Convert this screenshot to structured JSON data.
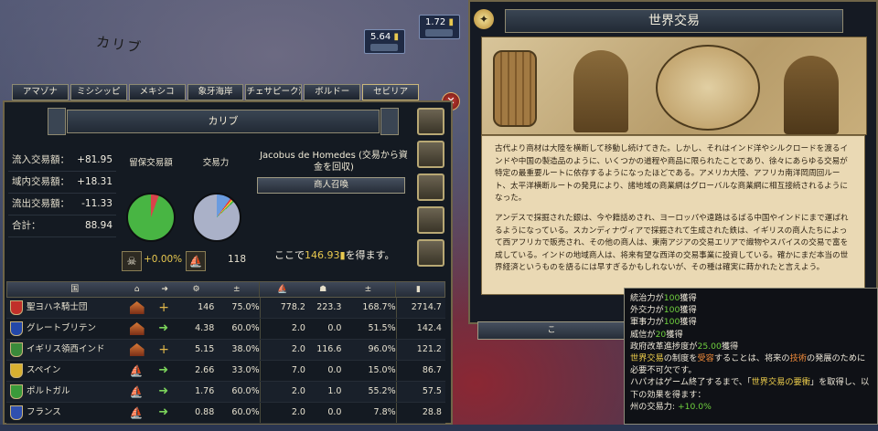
{
  "map": {
    "region_label": "カリブ",
    "badge_left": "5.64",
    "badge_right": "1.72"
  },
  "tabs": [
    "アマゾナ",
    "ミシシッピ",
    "メキシコ",
    "象牙海岸",
    "チェサピーク湾",
    "ボルドー",
    "セビリア"
  ],
  "trade_node": {
    "title": "カリブ",
    "close_label": "✕",
    "stats": [
      {
        "label": "流入交易額：",
        "value": "+81.95"
      },
      {
        "label": "域内交易額：",
        "value": "+18.31"
      },
      {
        "label": "流出交易額：",
        "value": "-11.33"
      },
      {
        "label": "合計：",
        "value": "88.94"
      }
    ],
    "retained_header": "留保交易額",
    "power_header": "交易力",
    "retained_value": "+0.00%",
    "power_value": "118",
    "merchant_title": "Jacobus de Homedes (交易から資金を回収)",
    "merchant_button": "商人召喚",
    "gain_prefix": "ここで",
    "gain_value": "146.93",
    "gain_suffix": "を得ます。"
  },
  "table": {
    "headers": [
      "国",
      "",
      "",
      "",
      "",
      "",
      "",
      "",
      ""
    ],
    "rows": [
      {
        "name": "聖ヨハネ騎士団",
        "v1": "146",
        "v2": "75.0%",
        "v3": "778.2",
        "v4": "223.3",
        "v5": "168.7%",
        "v6": "2714.7",
        "flag_color": "#c0302a"
      },
      {
        "name": "グレートブリテン",
        "v1": "4.38",
        "v2": "60.0%",
        "v3": "2.0",
        "v4": "0.0",
        "v5": "51.5%",
        "v6": "142.4",
        "flag_color": "#2448a8"
      },
      {
        "name": "イギリス領西インド",
        "v1": "5.15",
        "v2": "38.0%",
        "v3": "2.0",
        "v4": "116.6",
        "v5": "96.0%",
        "v6": "121.2",
        "flag_color": "#3a8a3a"
      },
      {
        "name": "スペイン",
        "v1": "2.66",
        "v2": "33.0%",
        "v3": "7.0",
        "v4": "0.0",
        "v5": "15.0%",
        "v6": "86.7",
        "flag_color": "#d8b030"
      },
      {
        "name": "ポルトガル",
        "v1": "1.76",
        "v2": "60.0%",
        "v3": "2.0",
        "v4": "1.0",
        "v5": "55.2%",
        "v6": "57.5",
        "flag_color": "#3a9a3a"
      },
      {
        "name": "フランス",
        "v1": "0.88",
        "v2": "60.0%",
        "v3": "2.0",
        "v4": "0.0",
        "v5": "7.8%",
        "v6": "28.8",
        "flag_color": "#3050b0"
      }
    ]
  },
  "event": {
    "title": "世界交易",
    "paragraph1": "古代より商材は大陸を横断して移動し続けてきた。しかし、それはインド洋やシルクロードを渡るインドや中国の製造品のように、いくつかの道程や商品に限られたことであり、徐々にあらゆる交易が特定の最重要ルートに依存するようになったほどである。アメリカ大陸、アフリカ南洋岡周回ルート、太平洋横断ルートの発見により、諸地域の商業網はグローバルな商業網に相互接続されるようになった。",
    "paragraph2": "アンデスで採掘された銀は、今や籍話めされ、ヨーロッパや遠路はるばる中国やインドにまで運ばれるようになっている。スカンディナヴィアで採掘されて生成された鉄は、イギリスの商人たちによって西アフリカで販売され、その他の商人は、東南アジアの交易エリアで織物やスパイスの交易で富を成している。インドの地域商人は、将来有望な西洋の交易事業に投資している。確かにまだ本当の世界経済というものを語るには早すぎるかもしれないが、その種は確実に蒔かれたと言えよう。",
    "button_label": "こ"
  },
  "tooltip": {
    "line1_prefix": "統治力が",
    "line1_num": "100",
    "line1_suffix": "獲得",
    "line2_prefix": "外交力が",
    "line2_num": "100",
    "line2_suffix": "獲得",
    "line3_prefix": "軍事力が",
    "line3_num": "100",
    "line3_suffix": "獲得",
    "line4_prefix": "威信が",
    "line4_num": "20",
    "line4_suffix": "獲得",
    "line5_prefix": "政府改革進捗度が",
    "line5_num": "25.00",
    "line5_suffix": "獲得",
    "line6_a": "世界交易",
    "line6_b": "の制度を",
    "line6_c": "受容",
    "line6_d": "することは、将来の",
    "line6_e": "技術",
    "line6_f": "の発展のために必要不可欠です。",
    "line7_a": "ハパオはゲーム終了するまで、「",
    "line7_b": "世界交易の要衝",
    "line7_c": "」を取得し、以下の効果を得ます：",
    "line8_prefix": "州の交易力: ",
    "line8_num": "+10.0%"
  },
  "colors": {
    "accent_gold": "#e9c94f",
    "positive_green": "#70d13f",
    "panel_border": "#6f6548"
  }
}
